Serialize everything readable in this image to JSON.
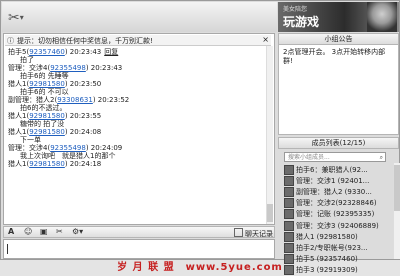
{
  "banner": {
    "small_text": "美女陪您",
    "big_text": "玩游戏"
  },
  "chat": {
    "tip_text": "提示：切勿相信任何中奖信息，千万别汇款!",
    "messages": [
      {
        "name": "拍手5(",
        "id": "92357460",
        "time": ") 20:23:43",
        "recall": "回复",
        "text": "拍了"
      },
      {
        "name": "管理：交涉4(",
        "id": "92355498",
        "time": ") 20:23:43",
        "recall": "",
        "text": "拍手6的 先睡等"
      },
      {
        "name": "猎人1(",
        "id": "92981580",
        "time": ") 20:23:50",
        "recall": "",
        "text": "拍手6的 不可以"
      },
      {
        "name": "副管理：猎人2(",
        "id": "93308631",
        "time": ") 20:23:52",
        "recall": "",
        "text": "拍6的不透过。"
      },
      {
        "name": "猎人1(",
        "id": "92981580",
        "time": ") 20:23:55",
        "recall": "",
        "text": "糖带的 拍了没"
      },
      {
        "name": "猎人1(",
        "id": "92981580",
        "time": ") 20:24:08",
        "recall": "",
        "text": "下一单"
      },
      {
        "name": "管理：交涉4(",
        "id": "92355498",
        "time": ") 20:24:09",
        "recall": "",
        "text": "我上次询吧　就是猎人1的那个"
      },
      {
        "name": "猎人1(",
        "id": "92981580",
        "time": ") 20:24:18",
        "recall": "",
        "text": ""
      }
    ]
  },
  "toolbar": {
    "history_label": "聊天记录"
  },
  "announcement": {
    "title": "小组公告",
    "body": "2点管理开会。 3点开始转移内部群!"
  },
  "members": {
    "title": "成员列表(12/15)",
    "search_placeholder": "搜索小组成员...",
    "list": [
      "拍手6：兼职猎人(92...",
      "管理：交涉1 (92401...",
      "副管理：猎人2 (9330...",
      "管理：交涉2(92328846)",
      "管理：记账 (92395335)",
      "管理：交涉3 (92406889)",
      "猎人1 (92981580)",
      "拍手2/专职帐号(923...",
      "拍手5 (92357460)",
      "拍手3 (92919309)"
    ]
  },
  "watermark": "岁 月 联 盟　www.5yue.com"
}
